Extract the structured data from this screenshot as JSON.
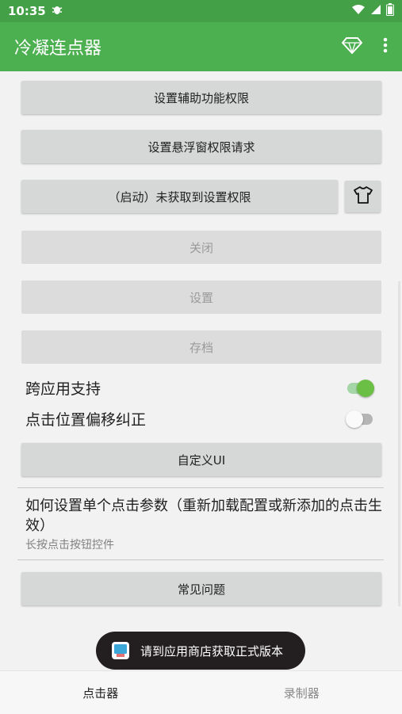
{
  "status_bar": {
    "time": "10:35",
    "notification_icon": "bug-icon",
    "icons": [
      "wifi-icon",
      "signal-icon",
      "battery-icon"
    ]
  },
  "app_bar": {
    "title": "冷凝连点器",
    "actions": [
      "diamond-icon",
      "more-vert-icon"
    ],
    "accent_color": "#4caf50"
  },
  "buttons": {
    "accessibility": "设置辅助功能权限",
    "overlay": "设置悬浮窗权限请求",
    "start": "（启动）未获取到设置权限",
    "theme_icon": "tshirt-icon",
    "close": "关闭",
    "settings": "设置",
    "archive": "存档",
    "custom_ui": "自定义UI",
    "faq": "常见问题"
  },
  "toggles": {
    "cross_app": {
      "label": "跨应用支持",
      "on": true
    },
    "offset_correction": {
      "label": "点击位置偏移纠正",
      "on": false
    }
  },
  "howto": {
    "title": "如何设置单个点击参数（重新加载配置或新添加的点击生效）",
    "subtitle": "长按点击按钮控件"
  },
  "toast": {
    "text": "请到应用商店获取正式版本"
  },
  "bottom_nav": {
    "tabs": [
      {
        "label": "点击器",
        "active": true
      },
      {
        "label": "录制器",
        "active": false
      }
    ]
  }
}
